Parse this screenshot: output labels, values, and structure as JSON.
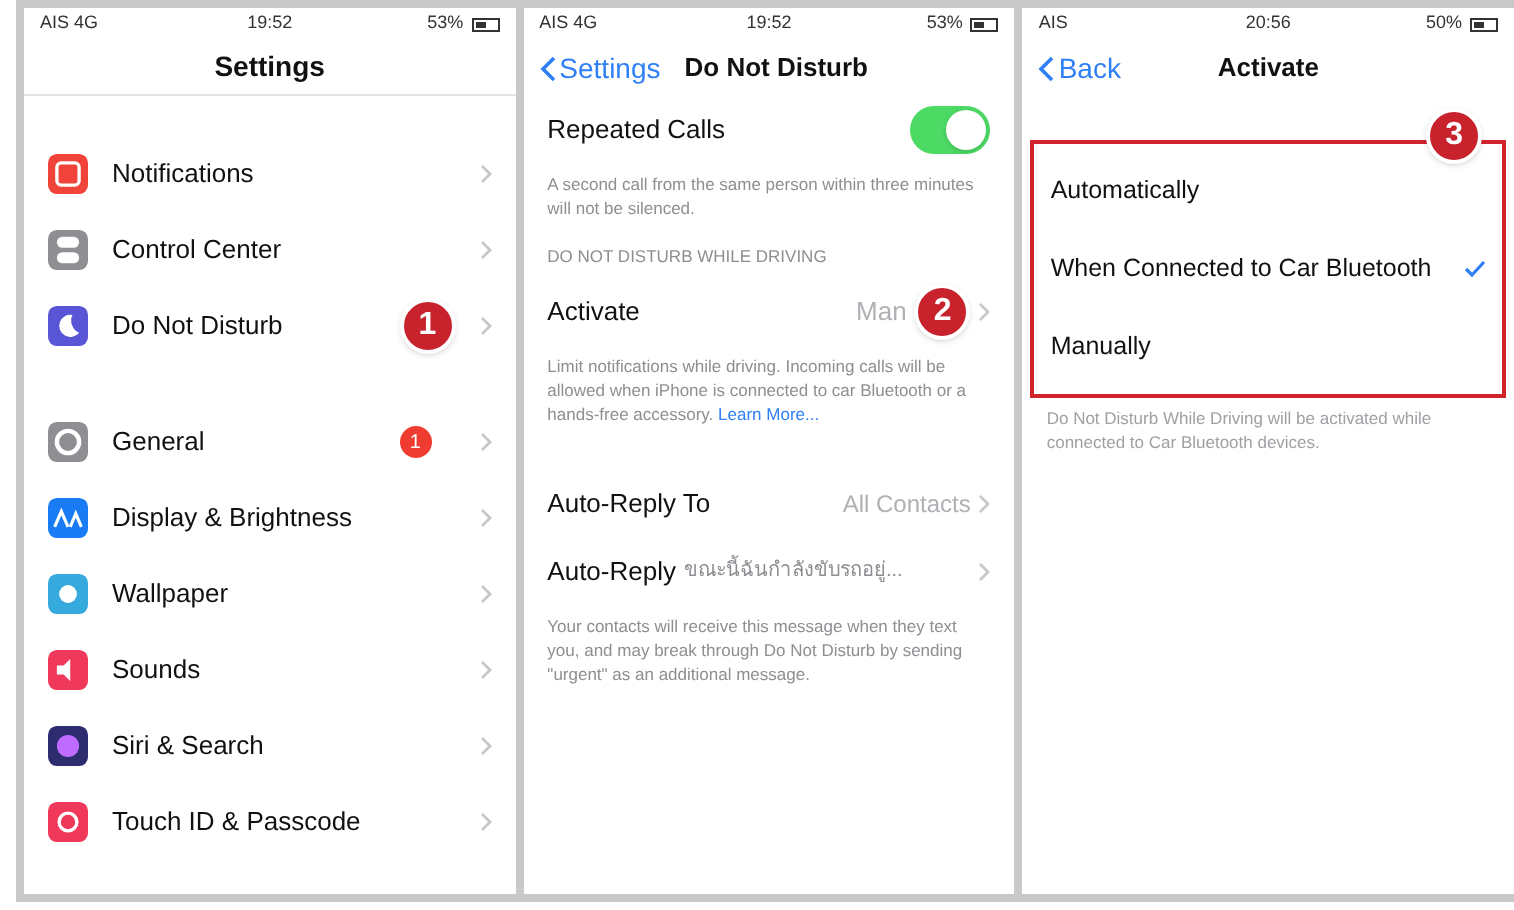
{
  "settings_screen": {
    "status_bar": {
      "carrier": "AIS 4G",
      "time": "19:52",
      "battery": "53%"
    },
    "title": "Settings",
    "groups": [
      [
        {
          "label": "Notifications",
          "color": "#f0443a"
        },
        {
          "label": "Control Center",
          "color": "#8e8e93"
        },
        {
          "label": "Do Not Disturb",
          "color": "#5856d6",
          "callout": "1"
        }
      ],
      [
        {
          "label": "General",
          "color": "#8e8e93",
          "badge": "1"
        },
        {
          "label": "Display & Brightness",
          "color": "#1a7cf5"
        },
        {
          "label": "Wallpaper",
          "color": "#36aadc"
        },
        {
          "label": "Sounds",
          "color": "#f0385a"
        },
        {
          "label": "Siri & Search",
          "color": "#2c2c6e"
        },
        {
          "label": "Touch ID & Passcode",
          "color": "#f0385a"
        }
      ]
    ]
  },
  "dnd_screen": {
    "status_bar": {
      "carrier": "AIS 4G",
      "time": "19:52",
      "battery": "53%"
    },
    "back": "Settings",
    "title": "Do Not Disturb",
    "repeated_calls": {
      "label": "Repeated Calls",
      "on": true
    },
    "repeated_note": "A second call from the same person within three minutes will not be silenced.",
    "section_header": "DO NOT DISTURB WHILE DRIVING",
    "activate": {
      "label": "Activate",
      "value": "Man",
      "callout": "2"
    },
    "driving_note": "Limit notifications while driving. Incoming calls will be allowed when iPhone is connected to car Bluetooth or a hands-free accessory.",
    "learn_more": "Learn More...",
    "auto_reply_to": {
      "label": "Auto-Reply To",
      "value": "All Contacts"
    },
    "auto_reply": {
      "label": "Auto-Reply",
      "value": "ขณะนี้ฉันกำลังขับรถอยู่..."
    },
    "reply_note": "Your contacts will receive this message when they text you, and may break through Do Not Disturb by sending \"urgent\" as an additional message."
  },
  "activate_screen": {
    "status_bar": {
      "carrier": "AIS",
      "time": "20:56",
      "battery": "50%"
    },
    "back": "Back",
    "title": "Activate",
    "callout": "3",
    "options": [
      {
        "label": "Automatically",
        "selected": false
      },
      {
        "label": "When Connected to Car Bluetooth",
        "selected": true
      },
      {
        "label": "Manually",
        "selected": false
      }
    ],
    "note": "Do Not Disturb While Driving will be activated while connected to Car Bluetooth devices."
  }
}
